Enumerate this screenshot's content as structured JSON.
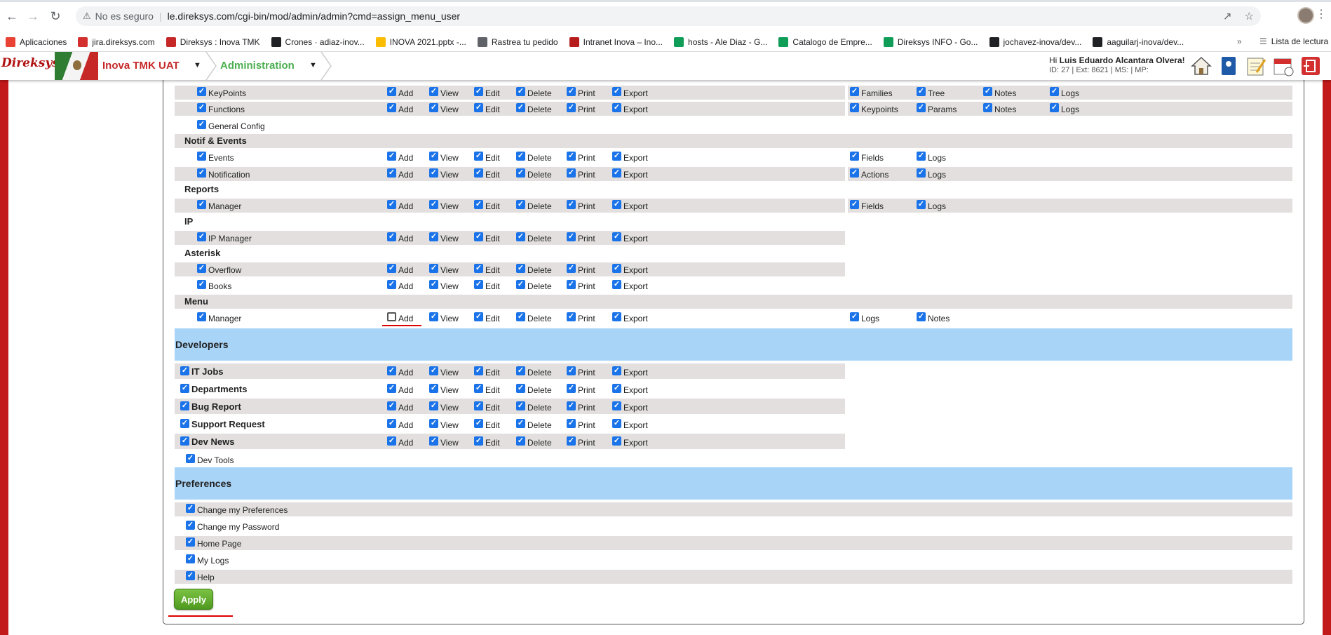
{
  "browser": {
    "insecure_label": "No es seguro",
    "url": "le.direksys.com/cgi-bin/mod/admin/admin?cmd=assign_menu_user",
    "bookmarks": [
      {
        "label": "Aplicaciones",
        "color": "#ea4335"
      },
      {
        "label": "jira.direksys.com",
        "color": "#d32f2f"
      },
      {
        "label": "Direksys : Inova TMK",
        "color": "#c62828"
      },
      {
        "label": "Crones · adiaz-inov...",
        "color": "#202124"
      },
      {
        "label": "INOVA 2021.pptx -...",
        "color": "#fbbc04"
      },
      {
        "label": "Rastrea tu pedido",
        "color": "#5f6368"
      },
      {
        "label": "Intranet Inova – Ino...",
        "color": "#b71c1c"
      },
      {
        "label": "hosts - Ale Diaz - G...",
        "color": "#0f9d58"
      },
      {
        "label": "Catalogo de Empre...",
        "color": "#0f9d58"
      },
      {
        "label": "Direksys INFO - Go...",
        "color": "#0f9d58"
      },
      {
        "label": "jochavez-inova/dev...",
        "color": "#202124"
      },
      {
        "label": "aaguilarj-inova/dev...",
        "color": "#202124"
      }
    ],
    "more": "»",
    "reading_list": "Lista de lectura"
  },
  "header": {
    "logo": "Direksys",
    "company": "Inova TMK UAT",
    "module": "Administration",
    "greeting_prefix": "Hi ",
    "user_name": "Luis Eduardo Alcantara Olvera!",
    "user_info": "ID: 27 | Ext: 8621 | MS: | MP:"
  },
  "perm_labels": [
    "Add",
    "View",
    "Edit",
    "Delete",
    "Print",
    "Export"
  ],
  "rows": [
    {
      "label": "KeyPoints",
      "perms": [
        true,
        true,
        true,
        true,
        true,
        true
      ],
      "extras": [
        {
          "label": "Families",
          "checked": true
        },
        {
          "label": "Tree",
          "checked": true
        },
        {
          "label": "Notes",
          "checked": true
        },
        {
          "label": "Logs",
          "checked": true
        }
      ]
    },
    {
      "label": "Functions",
      "perms": [
        true,
        true,
        true,
        true,
        true,
        true
      ],
      "extras": [
        {
          "label": "Keypoints",
          "checked": true
        },
        {
          "label": "Params",
          "checked": true
        },
        {
          "label": "Notes",
          "checked": true
        },
        {
          "label": "Logs",
          "checked": true
        }
      ]
    },
    {
      "label": "General Config",
      "perms": null,
      "extras": []
    },
    {
      "section": "Notif & Events"
    },
    {
      "label": "Events",
      "perms": [
        true,
        true,
        true,
        true,
        true,
        true
      ],
      "extras": [
        {
          "label": "Fields",
          "checked": true
        },
        {
          "label": "Logs",
          "checked": true
        }
      ]
    },
    {
      "label": "Notification",
      "perms": [
        true,
        true,
        true,
        true,
        true,
        true
      ],
      "extras": [
        {
          "label": "Actions",
          "checked": true
        },
        {
          "label": "Logs",
          "checked": true
        }
      ]
    },
    {
      "section": "Reports"
    },
    {
      "label": "Manager",
      "perms": [
        true,
        true,
        true,
        true,
        true,
        true
      ],
      "extras": [
        {
          "label": "Fields",
          "checked": true
        },
        {
          "label": "Logs",
          "checked": true
        }
      ]
    },
    {
      "section": "IP"
    },
    {
      "label": "IP Manager",
      "perms": [
        true,
        true,
        true,
        true,
        true,
        true
      ],
      "extras": []
    },
    {
      "section": "Asterisk"
    },
    {
      "label": "Overflow",
      "perms": [
        true,
        true,
        true,
        true,
        true,
        true
      ],
      "extras": []
    },
    {
      "label": "Books",
      "perms": [
        true,
        true,
        true,
        true,
        true,
        true
      ],
      "extras": []
    },
    {
      "section": "Menu"
    },
    {
      "label": "Manager",
      "perms": [
        false,
        true,
        true,
        true,
        true,
        true
      ],
      "extras": [
        {
          "label": "Logs",
          "checked": true
        },
        {
          "label": "Notes",
          "checked": true
        }
      ]
    }
  ],
  "developers": {
    "title": "Developers",
    "rows": [
      {
        "label": "IT Jobs",
        "perms": [
          true,
          true,
          true,
          true,
          true,
          true
        ]
      },
      {
        "label": "Departments",
        "perms": [
          true,
          true,
          true,
          true,
          true,
          true
        ]
      },
      {
        "label": "Bug Report",
        "perms": [
          true,
          true,
          true,
          true,
          true,
          true
        ]
      },
      {
        "label": "Support Request",
        "perms": [
          true,
          true,
          true,
          true,
          true,
          true
        ]
      },
      {
        "label": "Dev News",
        "perms": [
          true,
          true,
          true,
          true,
          true,
          true
        ]
      }
    ],
    "tools": "Dev Tools"
  },
  "preferences": {
    "title": "Preferences",
    "items": [
      "Change my Preferences",
      "Change my Password",
      "Home Page",
      "My Logs",
      "Help"
    ]
  },
  "apply_label": "Apply"
}
